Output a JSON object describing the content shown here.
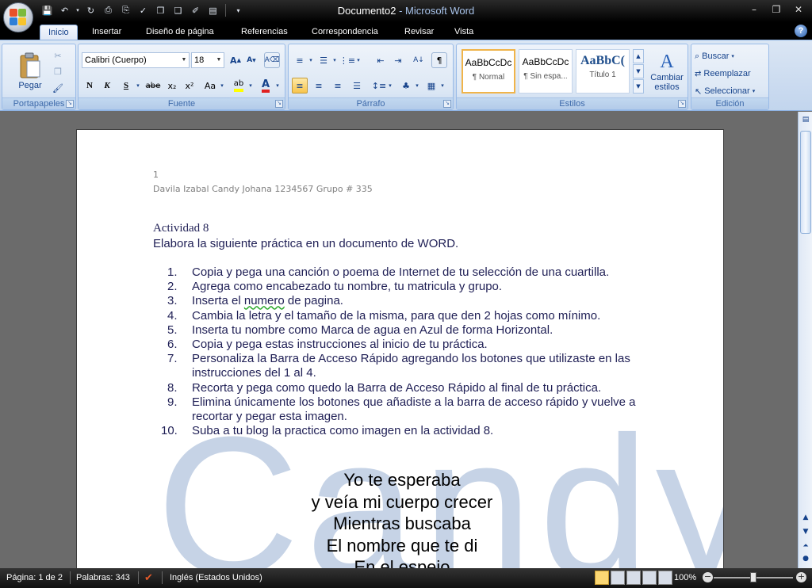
{
  "window": {
    "title_doc": "Documento2",
    "title_sep": " - ",
    "title_app": "Microsoft Word"
  },
  "tabs": [
    "Inicio",
    "Insertar",
    "Diseño de página",
    "Referencias",
    "Correspondencia",
    "Revisar",
    "Vista"
  ],
  "ribbon": {
    "clipboard": {
      "paste_label": "Pegar",
      "group_label": "Portapapeles"
    },
    "font": {
      "font_name": "Calibri (Cuerpo)",
      "font_size": "18",
      "bold": "N",
      "italic": "K",
      "underline": "S",
      "strike": "abe",
      "subscript": "x₂",
      "superscript": "x²",
      "case": "Aa",
      "group_label": "Fuente"
    },
    "paragraph": {
      "group_label": "Párrafo"
    },
    "styles": {
      "items": [
        {
          "sample": "AaBbCcDc",
          "name": "¶ Normal"
        },
        {
          "sample": "AaBbCcDc",
          "name": "¶ Sin espa..."
        },
        {
          "sample": "AaBbC(",
          "name": "Título 1"
        }
      ],
      "change_label_1": "Cambiar",
      "change_label_2": "estilos",
      "group_label": "Estilos"
    },
    "editing": {
      "find": "Buscar",
      "replace": "Reemplazar",
      "select": "Seleccionar",
      "group_label": "Edición"
    }
  },
  "document": {
    "header_page_number": "1",
    "header_line": "Davila Izabal Candy Johana 1234567   Grupo # 335",
    "activity_title": "Actividad 8",
    "activity_subtitle": "Elabora la siguiente práctica en un documento  de WORD.",
    "instructions": [
      {
        "num": "1.",
        "text": "Copia y pega una canción o poema de Internet de tu selección de una cuartilla."
      },
      {
        "num": "2.",
        "text": "Agrega como encabezado tu nombre, tu matricula y grupo."
      },
      {
        "num": "3.",
        "pre": "Inserta el ",
        "wavy": "numero",
        "post": " de pagina."
      },
      {
        "num": "4.",
        "text": "Cambia la letra y el tamaño de la misma, para que den 2 hojas como mínimo."
      },
      {
        "num": "5.",
        "text": "Inserta tu nombre como Marca de agua en Azul de forma Horizontal."
      },
      {
        "num": "6.",
        "text": "Copia y pega estas instrucciones  al inicio de tu práctica."
      },
      {
        "num": "7.",
        "text": "Personaliza la Barra de Acceso Rápido agregando los botones que utilizaste en las instrucciones del 1 al 4."
      },
      {
        "num": "8.",
        "text": "Recorta y pega como quedo la Barra de Acceso Rápido al final de tu práctica."
      },
      {
        "num": "9.",
        "text": "Elimina únicamente los botones que añadiste a la barra de acceso rápido y vuelve a recortar  y pegar esta imagen."
      },
      {
        "num": "10.",
        "text": "Suba a tu blog la practica como imagen en la actividad 8."
      }
    ],
    "poem_lines": [
      "Yo te esperaba",
      "y veía mi cuerpo crecer",
      "Mientras buscaba",
      "El nombre que te di",
      "En el espejo"
    ],
    "watermark": "Candy"
  },
  "status": {
    "page": "Página: 1 de 2",
    "words": "Palabras: 343",
    "language": "Inglés (Estados Unidos)",
    "zoom": "100%"
  },
  "colors": {
    "ribbon_bg": "#c8d9ef",
    "watermark": "#c6d3e6",
    "text_blue": "#15428b",
    "status_bg": "#1a1a1a"
  }
}
